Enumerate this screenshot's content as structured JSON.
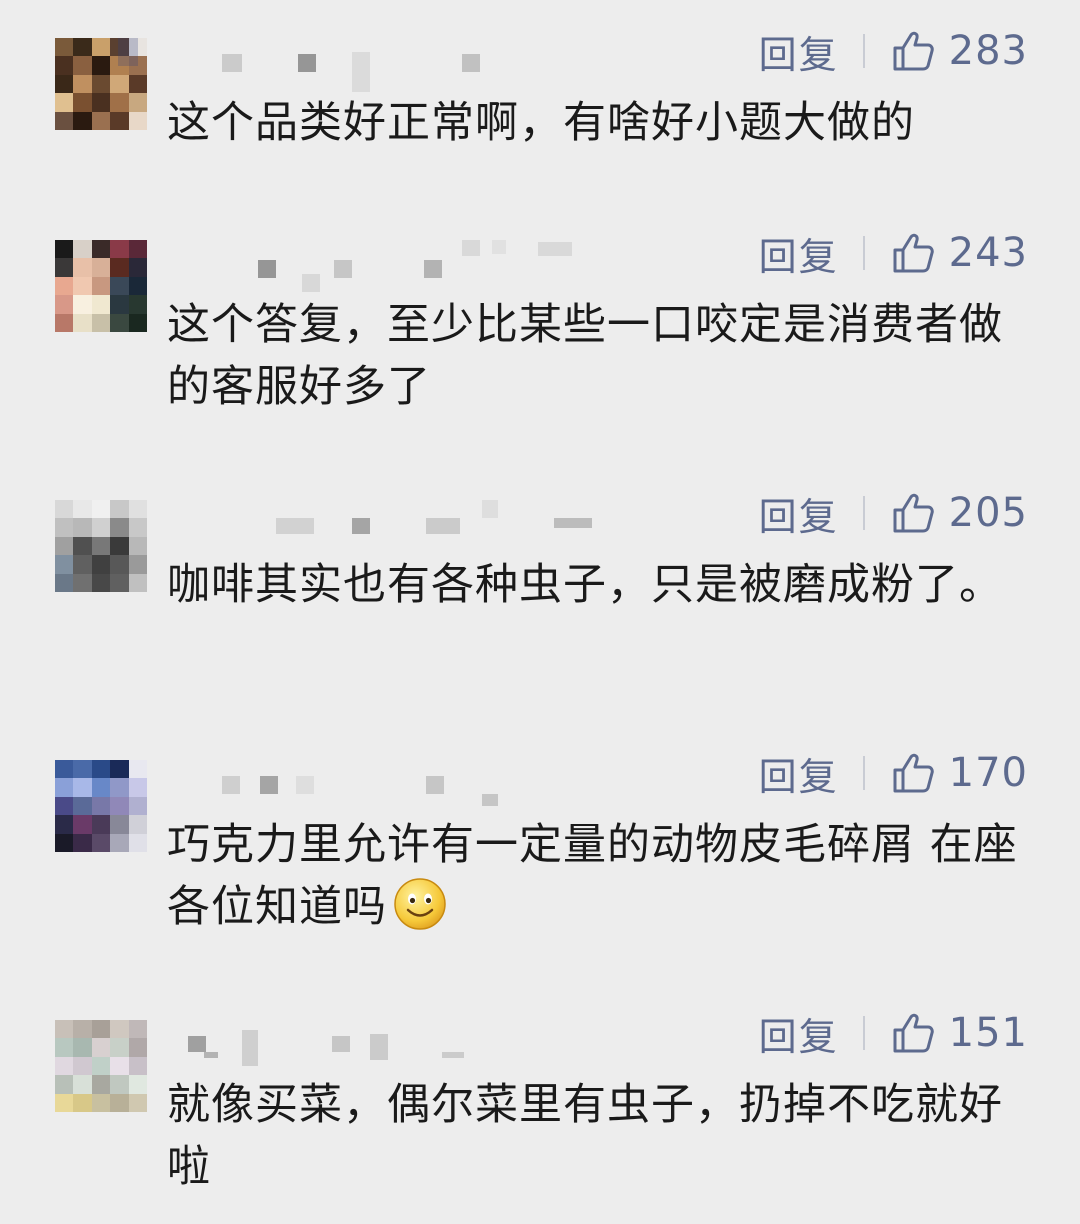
{
  "comments": [
    {
      "reply_label": "回复",
      "likes": "283",
      "text": "这个品类好正常啊，有啥好小题大做的",
      "avatar_colors": [
        "#7a5a3a",
        "#3a2a1a",
        "#c9a06a",
        "#5a4030",
        "#e8e4e0",
        "#4a3020",
        "#8a6040",
        "#2a1a10",
        "#b08050",
        "#9a7050",
        "#3a2818",
        "#c09060",
        "#6a4a30",
        "#d0a878",
        "#5a3a28",
        "#e0c090",
        "#7a5030",
        "#4a3020",
        "#a07048",
        "#c8a880",
        "#6a5040",
        "#2a1a10",
        "#9a7050",
        "#5a3a28",
        "#e8d8c8"
      ]
    },
    {
      "reply_label": "回复",
      "likes": "243",
      "text": "这个答复，至少比某些一口咬定是消费者做的客服好多了",
      "avatar_colors": [
        "#1a1a1a",
        "#d8d0c8",
        "#3a2a28",
        "#8a3a48",
        "#5a2838",
        "#3a3838",
        "#e8c0a8",
        "#d8b098",
        "#5a2a20",
        "#2a2838",
        "#e8a890",
        "#f0c8b0",
        "#c89880",
        "#3a4858",
        "#1a2838",
        "#d89888",
        "#f8f0e0",
        "#f0e8d0",
        "#2a3840",
        "#283830",
        "#b87868",
        "#e8e0c8",
        "#c8c0a8",
        "#3a4840",
        "#1a2820"
      ]
    },
    {
      "reply_label": "回复",
      "likes": "205",
      "text": "咖啡其实也有各种虫子，只是被磨成粉了。",
      "avatar_colors": [
        "#d8d8d8",
        "#e8e8e8",
        "#f0f0f0",
        "#c8c8c8",
        "#e0e0e0",
        "#c0c0c0",
        "#b8b8b8",
        "#d0d0d0",
        "#8a8a8a",
        "#c8c8c8",
        "#a0a0a0",
        "#505050",
        "#787878",
        "#3a3a3a",
        "#b8b8b8",
        "#8090a0",
        "#606060",
        "#404040",
        "#585858",
        "#9a9a9a",
        "#6a7888",
        "#707070",
        "#484848",
        "#606060",
        "#c0c0c0"
      ]
    },
    {
      "reply_label": "回复",
      "likes": "170",
      "text": "巧克力里允许有一定量的动物皮毛碎屑 在座各位知道吗",
      "has_emoji": true,
      "avatar_colors": [
        "#3a5a9a",
        "#4a6aa8",
        "#2a4a88",
        "#1a2a58",
        "#e8e8f0",
        "#8aa0d8",
        "#a8b8e8",
        "#6888c8",
        "#9098c8",
        "#c8c8e8",
        "#4a4a88",
        "#5a6a98",
        "#7878a8",
        "#9088b8",
        "#b0b0d0",
        "#2a2a48",
        "#6a3a68",
        "#4a3a58",
        "#888898",
        "#d0d0d8",
        "#1a1a28",
        "#3a2a48",
        "#5a4a68",
        "#a8a8b8",
        "#e0e0e8"
      ]
    },
    {
      "reply_label": "回复",
      "likes": "151",
      "text": "就像买菜，偶尔菜里有虫子，扔掉不吃就好啦",
      "avatar_colors": [
        "#c8c0b8",
        "#b8b0a8",
        "#a8a098",
        "#d0c8c0",
        "#c0b8b8",
        "#b8c8c0",
        "#a8b8b0",
        "#d8d0d0",
        "#c8d0c8",
        "#b0a8a8",
        "#e0d8e0",
        "#d0c8d0",
        "#c0d0c8",
        "#e8e0e8",
        "#c8c0c8",
        "#b8c0b8",
        "#d8e0d8",
        "#a8a8a0",
        "#c0c8c0",
        "#e0e8e0",
        "#e8d898",
        "#d8c888",
        "#c8c0a0",
        "#b8b098",
        "#d0c8b0"
      ]
    }
  ]
}
